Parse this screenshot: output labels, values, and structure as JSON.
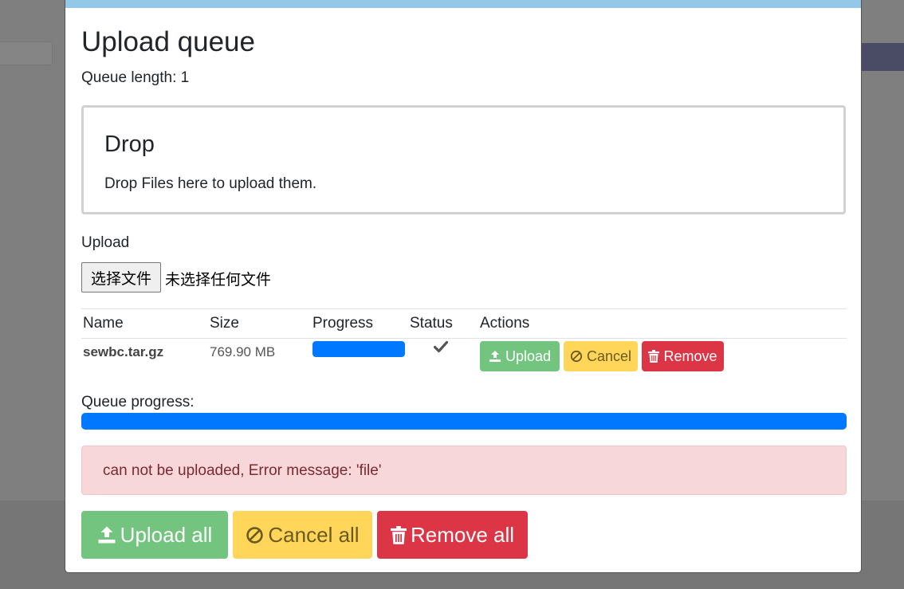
{
  "modal": {
    "title": "Upload queue",
    "queue_length": "Queue length: 1"
  },
  "drop": {
    "title": "Drop",
    "text": "Drop Files here to upload them."
  },
  "upload": {
    "label": "Upload",
    "file_button": "选择文件",
    "file_status": "未选择任何文件"
  },
  "table": {
    "headers": [
      "Name",
      "Size",
      "Progress",
      "Status",
      "Actions"
    ],
    "rows": [
      {
        "name": "sewbc.tar.gz",
        "size": "769.90 MB",
        "progress": 1.0,
        "status_icon": "check-icon",
        "actions": {
          "upload": "Upload",
          "cancel": "Cancel",
          "remove": "Remove"
        }
      }
    ]
  },
  "queue": {
    "label": "Queue progress:",
    "progress": 1.0
  },
  "alert": {
    "message": "can not be uploaded, Error message: 'file'"
  },
  "footer": {
    "upload_all": "Upload all",
    "cancel_all": "Cancel all",
    "remove_all": "Remove all"
  },
  "colors": {
    "success": "#72c47e",
    "warning": "#ffd65a",
    "danger": "#dc3545",
    "progress": "#0078ff",
    "modal_topbar": "#93c9e6"
  }
}
